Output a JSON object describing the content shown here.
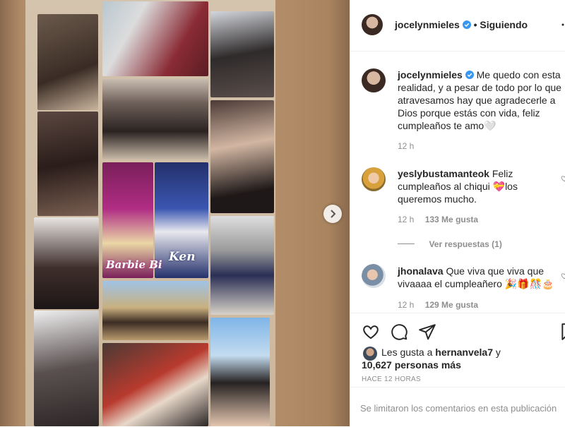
{
  "post": {
    "username": "jocelynmieles",
    "follow_state": "Siguiendo",
    "caption": "Me quedo con esta realidad, y a pesar de todo por lo que atravesamos hay que agradecerle a Dios porque estás con vida, feliz cumpleaños te amo🤍",
    "caption_time": "12 h"
  },
  "collage": {
    "labels": {
      "barbie": "Barbie Bi",
      "ken": "Ken"
    }
  },
  "comments": [
    {
      "username": "yeslybustamanteok",
      "text": "Feliz cumpleaños al chiqui 💝los queremos mucho.",
      "time": "12 h",
      "likes": "133 Me gusta",
      "replies_label": "Ver respuestas (1)"
    },
    {
      "username": "jhonalava",
      "text": "Que viva que viva que vivaaaa el cumpleañero 🎉🎁🎊🎂",
      "time": "12 h",
      "likes": "129 Me gusta"
    }
  ],
  "likes": {
    "prefix": "Les gusta a",
    "user": "hernanvela7",
    "conj": "y",
    "others": "10,627 personas más"
  },
  "timestamp": "HACE 12 HORAS",
  "comments_limited": "Se limitaron los comentarios en esta publicación",
  "colors": {
    "accent": "#0095f6",
    "muted": "#8e8e8e",
    "border": "#efefef"
  }
}
